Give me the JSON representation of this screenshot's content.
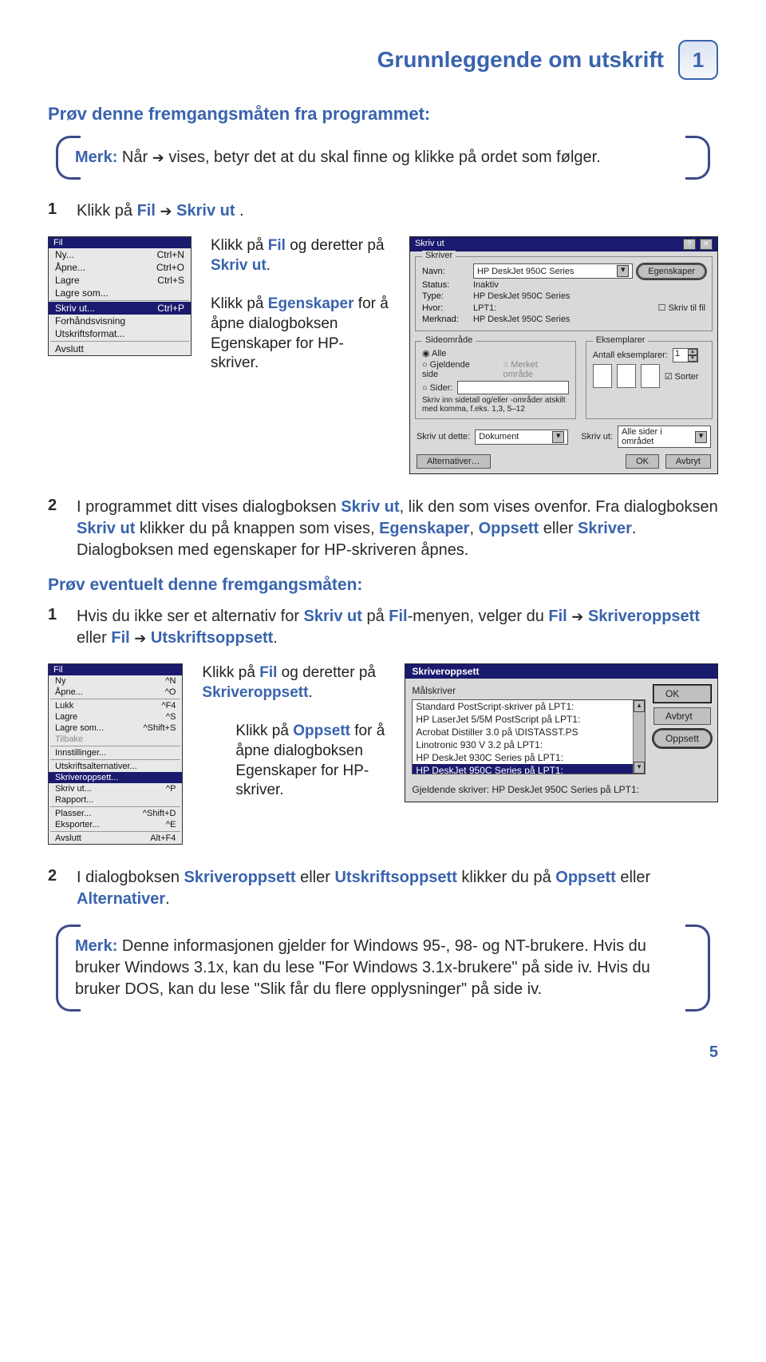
{
  "header": {
    "title": "Grunnleggende om utskrift",
    "chapter": "1"
  },
  "intro_subtitle": "Prøv denne fremgangsmåten fra programmet:",
  "note1": {
    "merk": "Merk:",
    "text_a": "Når ",
    "arrow": "➔",
    "text_b": " vises, betyr det at du skal finne og klikke på ordet som følger."
  },
  "step1": {
    "num": "1",
    "a": "Klikk på ",
    "fil": "Fil",
    "arrow": "➔",
    "skriv_ut": "Skriv ut",
    "dot": "."
  },
  "callouts1": {
    "c1a": "Klikk på ",
    "c1_fil": "Fil",
    "c1b": " og deretter på ",
    "c1_skriv": "Skriv ut",
    "c1c": ".",
    "c2a": "Klikk på ",
    "c2_eg": "Egenskaper",
    "c2b": " for å åpne dialogboksen Egenskaper for HP-skriver."
  },
  "menu1": {
    "title": "Fil",
    "items": [
      {
        "l": "Ny...",
        "r": "Ctrl+N"
      },
      {
        "l": "Åpne...",
        "r": "Ctrl+O"
      },
      {
        "l": "Lagre",
        "r": "Ctrl+S"
      },
      {
        "l": "Lagre som...",
        "r": ""
      },
      {
        "sep": true
      },
      {
        "l": "Skriv ut...",
        "r": "Ctrl+P",
        "sel": true
      },
      {
        "l": "Forhåndsvisning",
        "r": ""
      },
      {
        "l": "Utskriftsformat...",
        "r": ""
      },
      {
        "sep": true
      },
      {
        "l": "Avslutt",
        "r": ""
      }
    ]
  },
  "printdlg": {
    "title": "Skriv ut",
    "q": "?",
    "x": "✕",
    "g_skriver": "Skriver",
    "navn_l": "Navn:",
    "navn_v": "HP DeskJet 950C Series",
    "eg_btn": "Egenskaper",
    "status_l": "Status:",
    "status_v": "Inaktiv",
    "type_l": "Type:",
    "type_v": "HP DeskJet 950C Series",
    "hvor_l": "Hvor:",
    "hvor_v": "LPT1:",
    "merk_l": "Merknad:",
    "merk_v": "HP DeskJet 950C Series",
    "chk_fil": "Skriv til fil",
    "g_side": "Sideområde",
    "g_eks": "Eksemplarer",
    "r_alle": "Alle",
    "r_gj": "Gjeldende side",
    "r_merket": "Merket område",
    "r_sider": "Sider:",
    "hint": "Skriv inn sidetall og/eller -områder atskilt med komma, f.eks. 1,3, 5–12",
    "ant_l": "Antall eksemplarer:",
    "ant_v": "1",
    "chk_sort": "Sorter",
    "dette_l": "Skriv ut dette:",
    "dette_v": "Dokument",
    "ut_l": "Skriv ut:",
    "ut_v": "Alle sider i området",
    "alt": "Alternativer…",
    "ok": "OK",
    "avbryt": "Avbryt"
  },
  "step2": {
    "num": "2",
    "t1": "I programmet ditt vises dialogboksen ",
    "skriv_ut": "Skriv ut",
    "t2": ", lik den som vises ovenfor. Fra dialogboksen ",
    "skriv_ut2": "Skriv ut",
    "t3": " klikker du på knappen som vises, ",
    "eg": "Egenskaper",
    "komma": ", ",
    "opp": "Oppsett",
    "eller": " eller ",
    "skr": "Skriver",
    "t4": ". Dialogboksen med egenskaper for HP-skriveren åpnes."
  },
  "alt_title": "Prøv eventuelt denne fremgangsmåten:",
  "alt_step1": {
    "num": "1",
    "t1": "Hvis du ikke ser et alternativ for ",
    "skriv": "Skriv ut",
    "t2": " på ",
    "fil": "Fil",
    "t3": "-menyen, velger du ",
    "fil2": "Fil",
    "arrow": "➔",
    "so": "Skriveroppsett",
    "eller": " eller ",
    "fil3": "Fil",
    "arrow2": "➔",
    "uo": "Utskriftsoppsett",
    "dot": "."
  },
  "callouts2": {
    "c1a": "Klikk på ",
    "c1_fil": "Fil",
    "c1b": " og deretter på ",
    "c1_so": "Skriveroppsett",
    "c1c": ".",
    "c2a": "Klikk på ",
    "c2_opp": "Oppsett",
    "c2b": " for å åpne dialogboksen Egenskaper for HP-skriver."
  },
  "menu2": {
    "title": "Fil",
    "items": [
      {
        "l": "Ny",
        "r": "^N"
      },
      {
        "l": "Åpne...",
        "r": "^O"
      },
      {
        "sep": true
      },
      {
        "l": "Lukk",
        "r": "^F4"
      },
      {
        "l": "Lagre",
        "r": "^S"
      },
      {
        "l": "Lagre som...",
        "r": "^Shift+S"
      },
      {
        "l": "Tilbake",
        "r": "",
        "gray": true
      },
      {
        "sep": true
      },
      {
        "l": "Innstillinger...",
        "r": ""
      },
      {
        "sep": true
      },
      {
        "l": "Utskriftsalternativer...",
        "r": ""
      },
      {
        "l": "Skriveroppsett...",
        "r": "",
        "sel": true
      },
      {
        "l": "Skriv ut...",
        "r": "^P"
      },
      {
        "l": "Rapport...",
        "r": ""
      },
      {
        "sep": true
      },
      {
        "l": "Plasser...",
        "r": "^Shift+D"
      },
      {
        "l": "Eksporter...",
        "r": "^E"
      },
      {
        "sep": true
      },
      {
        "l": "Avslutt",
        "r": "Alt+F4"
      }
    ]
  },
  "dlg2": {
    "title": "Skriveroppsett",
    "mal": "Målskriver",
    "items": [
      "Standard PostScript-skriver på LPT1:",
      "HP LaserJet 5/5M PostScript på LPT1:",
      "Acrobat Distiller 3.0 på \\DISTASST.PS",
      "Linotronic 930 V 3.2 på LPT1:",
      "HP DeskJet 930C Series på LPT1:",
      "HP DeskJet 950C Series på LPT1:"
    ],
    "sel_index": 5,
    "ok": "OK",
    "avbryt": "Avbryt",
    "oppsett": "Oppsett",
    "status": "Gjeldende skriver: HP DeskJet 950C Series på LPT1:"
  },
  "step4": {
    "num": "2",
    "t1": "I dialogboksen ",
    "so": "Skriveroppsett",
    "eller": " eller ",
    "uo": "Utskriftsoppsett",
    "t2": " klikker du på ",
    "opp": "Oppsett",
    "eller2": " eller ",
    "alt": "Alternativer",
    "dot": "."
  },
  "note2": {
    "merk": "Merk:",
    "t": " Denne informasjonen gjelder for Windows 95-, 98- og NT-brukere. Hvis du bruker Windows 3.1x, kan du lese \"For Windows 3.1x-brukere\" på side iv. Hvis du bruker DOS, kan du lese \"Slik får du flere opplysninger\" på side iv."
  },
  "pagenum": "5"
}
